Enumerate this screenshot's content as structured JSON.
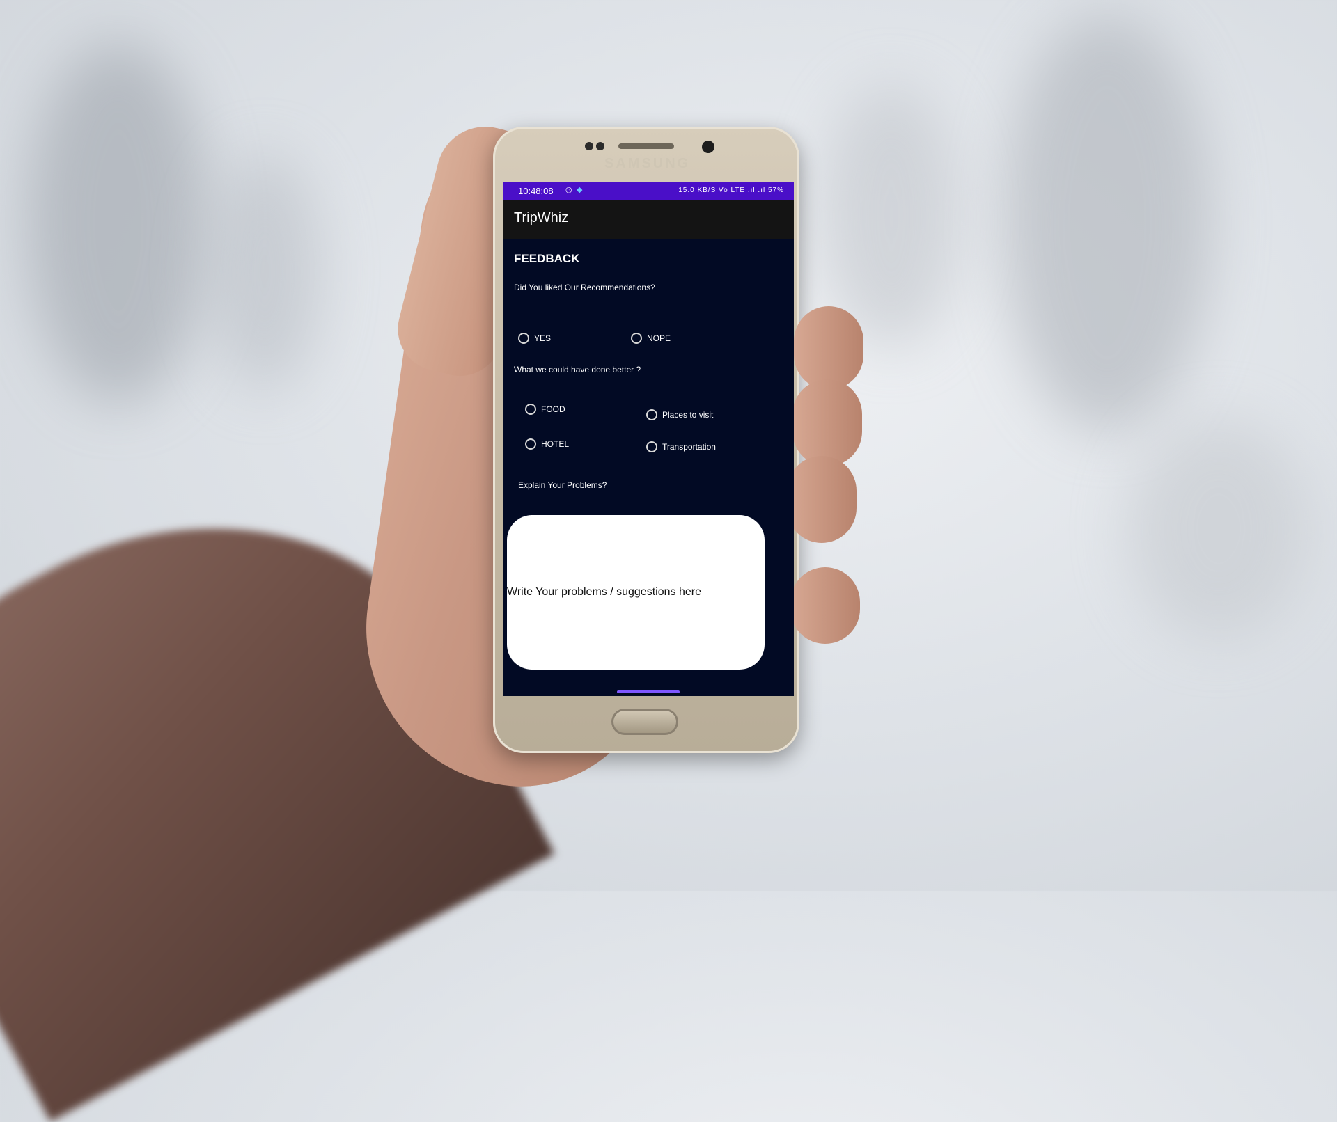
{
  "status_bar": {
    "time": "10:48:08",
    "icons_right": "15.0 KB/S  Vo LTE  .ıl  .ıl  57%"
  },
  "app": {
    "title": "TripWhiz"
  },
  "feedback": {
    "heading": "FEEDBACK",
    "question1": "Did You liked Our Recommendations?",
    "q1_options": [
      "YES",
      "NOPE"
    ],
    "question2": "What we could have done better ?",
    "q2_options": [
      "FOOD",
      "Places to visit",
      "HOTEL",
      "Transportation"
    ],
    "question3": "Explain Your Problems?",
    "text_area_placeholder": "Write Your problems / suggestions here"
  },
  "device": {
    "brand": "SAMSUNG"
  },
  "colors": {
    "status_bar": "#4a0fc8",
    "app_bar": "#141414",
    "screen_bg": "#020a24",
    "text": "#ffffff"
  }
}
